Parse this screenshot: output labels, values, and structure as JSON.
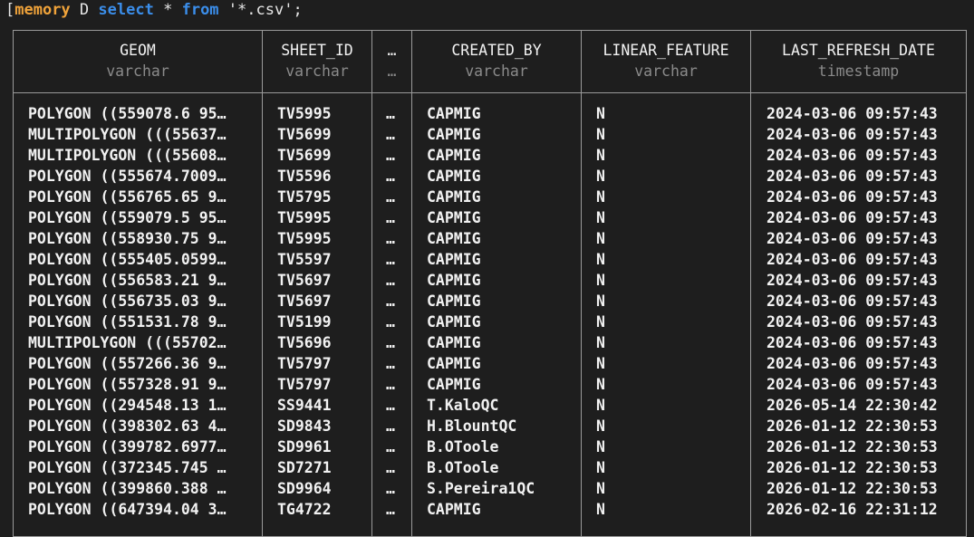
{
  "prompt": {
    "bracket": "[",
    "database": "memory",
    "indicator": "D",
    "kw_select": "select",
    "star": "*",
    "kw_from": "from",
    "source": "'*.csv';"
  },
  "columns": [
    {
      "name": "GEOM",
      "type": "varchar"
    },
    {
      "name": "SHEET_ID",
      "type": "varchar"
    },
    {
      "name": "…",
      "type": "…"
    },
    {
      "name": "CREATED_BY",
      "type": "varchar"
    },
    {
      "name": "LINEAR_FEATURE",
      "type": "varchar"
    },
    {
      "name": "LAST_REFRESH_DATE",
      "type": "timestamp"
    }
  ],
  "rows": [
    [
      "POLYGON ((559078.6 95…",
      "TV5995",
      "…",
      "CAPMIG",
      "N",
      "2024-03-06 09:57:43"
    ],
    [
      "MULTIPOLYGON (((55637…",
      "TV5699",
      "…",
      "CAPMIG",
      "N",
      "2024-03-06 09:57:43"
    ],
    [
      "MULTIPOLYGON (((55608…",
      "TV5699",
      "…",
      "CAPMIG",
      "N",
      "2024-03-06 09:57:43"
    ],
    [
      "POLYGON ((555674.7009…",
      "TV5596",
      "…",
      "CAPMIG",
      "N",
      "2024-03-06 09:57:43"
    ],
    [
      "POLYGON ((556765.65 9…",
      "TV5795",
      "…",
      "CAPMIG",
      "N",
      "2024-03-06 09:57:43"
    ],
    [
      "POLYGON ((559079.5 95…",
      "TV5995",
      "…",
      "CAPMIG",
      "N",
      "2024-03-06 09:57:43"
    ],
    [
      "POLYGON ((558930.75 9…",
      "TV5995",
      "…",
      "CAPMIG",
      "N",
      "2024-03-06 09:57:43"
    ],
    [
      "POLYGON ((555405.0599…",
      "TV5597",
      "…",
      "CAPMIG",
      "N",
      "2024-03-06 09:57:43"
    ],
    [
      "POLYGON ((556583.21 9…",
      "TV5697",
      "…",
      "CAPMIG",
      "N",
      "2024-03-06 09:57:43"
    ],
    [
      "POLYGON ((556735.03 9…",
      "TV5697",
      "…",
      "CAPMIG",
      "N",
      "2024-03-06 09:57:43"
    ],
    [
      "POLYGON ((551531.78 9…",
      "TV5199",
      "…",
      "CAPMIG",
      "N",
      "2024-03-06 09:57:43"
    ],
    [
      "MULTIPOLYGON (((55702…",
      "TV5696",
      "…",
      "CAPMIG",
      "N",
      "2024-03-06 09:57:43"
    ],
    [
      "POLYGON ((557266.36 9…",
      "TV5797",
      "…",
      "CAPMIG",
      "N",
      "2024-03-06 09:57:43"
    ],
    [
      "POLYGON ((557328.91 9…",
      "TV5797",
      "…",
      "CAPMIG",
      "N",
      "2024-03-06 09:57:43"
    ],
    [
      "POLYGON ((294548.13 1…",
      "SS9441",
      "…",
      "T.KaloQC",
      "N",
      "2026-05-14 22:30:42"
    ],
    [
      "POLYGON ((398302.63 4…",
      "SD9843",
      "…",
      "H.BlountQC",
      "N",
      "2026-01-12 22:30:53"
    ],
    [
      "POLYGON ((399782.6977…",
      "SD9961",
      "…",
      "B.OToole",
      "N",
      "2026-01-12 22:30:53"
    ],
    [
      "POLYGON ((372345.745 …",
      "SD7271",
      "…",
      "B.OToole",
      "N",
      "2026-01-12 22:30:53"
    ],
    [
      "POLYGON ((399860.388 …",
      "SD9964",
      "…",
      "S.Pereira1QC",
      "N",
      "2026-01-12 22:30:53"
    ],
    [
      "POLYGON ((647394.04 3…",
      "TG4722",
      "…",
      "CAPMIG",
      "N",
      "2026-02-16 22:31:12"
    ]
  ],
  "colors": {
    "background": "#1e1e1e",
    "grid": "#9a9a9a",
    "database": "#f0a33a",
    "keyword": "#3b8eea",
    "type_text": "#8a8a8a"
  }
}
